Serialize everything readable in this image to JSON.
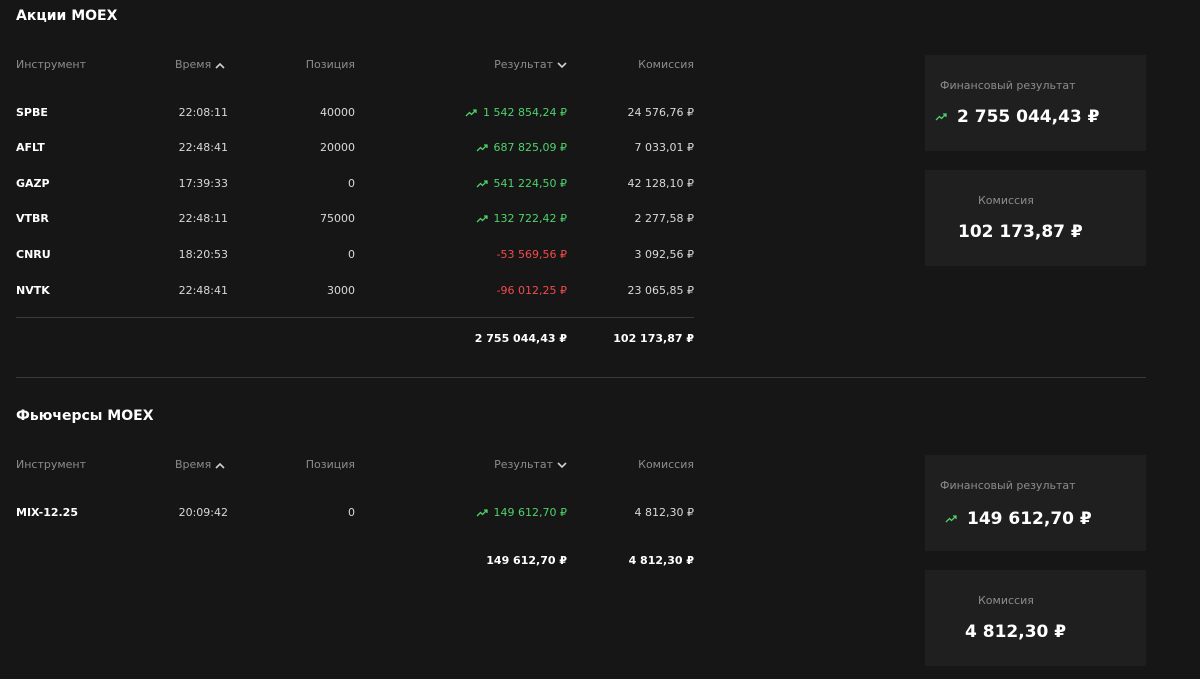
{
  "sections": [
    {
      "title": "Акции MOEX",
      "headers": {
        "instrument": "Инструмент",
        "time": "Время",
        "position": "Позиция",
        "result": "Результат",
        "commission": "Комиссия"
      },
      "rows": [
        {
          "ticker": "SPBE",
          "time": "22:08:11",
          "position": "40000",
          "result": "1 542 854,24 ₽",
          "result_sign": "pos",
          "commission": "24 576,76 ₽"
        },
        {
          "ticker": "AFLT",
          "time": "22:48:41",
          "position": "20000",
          "result": "687 825,09 ₽",
          "result_sign": "pos",
          "commission": "7 033,01 ₽"
        },
        {
          "ticker": "GAZP",
          "time": "17:39:33",
          "position": "0",
          "result": "541 224,50 ₽",
          "result_sign": "pos",
          "commission": "42 128,10 ₽"
        },
        {
          "ticker": "VTBR",
          "time": "22:48:11",
          "position": "75000",
          "result": "132 722,42 ₽",
          "result_sign": "pos",
          "commission": "2 277,58 ₽"
        },
        {
          "ticker": "CNRU",
          "time": "18:20:53",
          "position": "0",
          "result": "-53 569,56 ₽",
          "result_sign": "neg",
          "commission": "3 092,56 ₽"
        },
        {
          "ticker": "NVTK",
          "time": "22:48:41",
          "position": "3000",
          "result": "-96 012,25 ₽",
          "result_sign": "neg",
          "commission": "23 065,85 ₽"
        }
      ],
      "totals": {
        "result": "2 755 044,43 ₽",
        "commission": "102 173,87 ₽"
      },
      "cards": {
        "fin_label": "Финансовый результат",
        "fin_value": "2 755 044,43 ₽",
        "comm_label": "Комиссия",
        "comm_value": "102 173,87 ₽"
      }
    },
    {
      "title": "Фьючерсы MOEX",
      "headers": {
        "instrument": "Инструмент",
        "time": "Время",
        "position": "Позиция",
        "result": "Результат",
        "commission": "Комиссия"
      },
      "rows": [
        {
          "ticker": "MIX-12.25",
          "time": "20:09:42",
          "position": "0",
          "result": "149 612,70 ₽",
          "result_sign": "pos",
          "commission": "4 812,30 ₽"
        }
      ],
      "totals": {
        "result": "149 612,70 ₽",
        "commission": "4 812,30 ₽"
      },
      "cards": {
        "fin_label": "Финансовый результат",
        "fin_value": "149 612,70 ₽",
        "comm_label": "Комиссия",
        "comm_value": "4 812,30 ₽"
      }
    }
  ],
  "colors": {
    "background": "#161616",
    "card": "#1f1f1f",
    "positive": "#4fd16b",
    "negative": "#f24b4b",
    "muted": "#8c8c8c"
  },
  "icons": {
    "trend": "trending-up-icon",
    "sort_asc": "chevron-up-icon",
    "sort_desc": "chevron-down-icon"
  }
}
